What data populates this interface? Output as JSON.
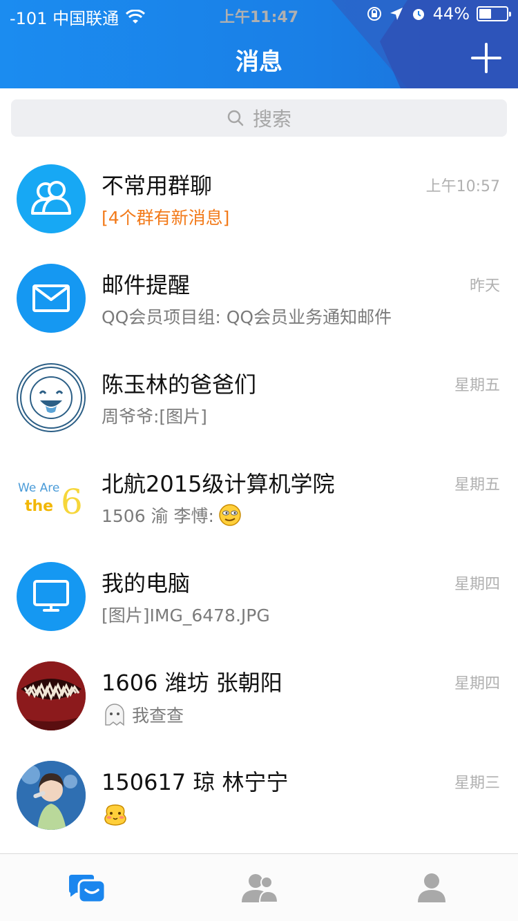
{
  "status_bar": {
    "carrier": "-101 中国联通",
    "time": "上午11:47",
    "battery": "44%",
    "battery_level": 0.44
  },
  "header": {
    "title": "消息"
  },
  "search": {
    "placeholder": "搜索"
  },
  "conversations": [
    {
      "name": "不常用群聊",
      "preview": "[4个群有新消息]",
      "time": "上午10:57",
      "avatar_icon": "group-icon"
    },
    {
      "name": "邮件提醒",
      "preview": "QQ会员项目组: QQ会员业务通知邮件",
      "time": "昨天",
      "avatar_icon": "mail-icon"
    },
    {
      "name": "陈玉林的爸爸们",
      "preview": "周爷爷:[图片]",
      "time": "星期五",
      "avatar_icon": "university-seal-avatar"
    },
    {
      "name": "北航2015级计算机学院",
      "preview": "1506  渝 李愽:",
      "time": "星期五",
      "avatar_icon": "we-are-the-6-logo"
    },
    {
      "name": "我的电脑",
      "preview": "[图片]IMG_6478.JPG",
      "time": "星期四",
      "avatar_icon": "computer-icon"
    },
    {
      "name": "1606 潍坊 张朝阳",
      "preview": "我查查",
      "time": "星期四",
      "avatar_icon": "red-mouth-avatar"
    },
    {
      "name": "150617 琼 林宁宁",
      "preview": "",
      "time": "星期三",
      "avatar_icon": "singer-photo-avatar"
    }
  ],
  "avatar_text": {
    "we_are": "We Are",
    "the": "the",
    "six": "6"
  },
  "tabs": [
    {
      "name": "messages",
      "icon": "messages-icon",
      "active": true
    },
    {
      "name": "contacts",
      "icon": "contacts-icon",
      "active": false
    },
    {
      "name": "profile",
      "icon": "profile-icon",
      "active": false
    }
  ],
  "colors": {
    "accent": "#1a86ee",
    "orange": "#f27a1a"
  }
}
